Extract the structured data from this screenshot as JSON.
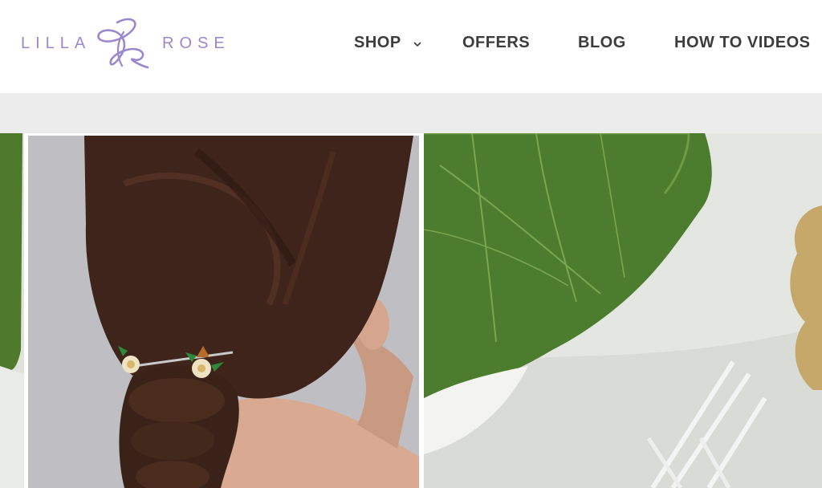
{
  "brand": {
    "left_word": "LILLA",
    "right_word": "ROSE",
    "accent_color": "#9b88cc"
  },
  "nav": {
    "items": [
      {
        "label": "SHOP",
        "has_dropdown": true,
        "icon": "chevron-down-icon"
      },
      {
        "label": "OFFERS"
      },
      {
        "label": "BLOG"
      },
      {
        "label": "HOW TO VIDEOS"
      }
    ]
  },
  "gallery": {
    "images": [
      {
        "name": "green-leaf-edge"
      },
      {
        "name": "braided-hair-with-rose-hair-pins"
      },
      {
        "name": "leaf-with-silver-hair-pins"
      }
    ]
  }
}
